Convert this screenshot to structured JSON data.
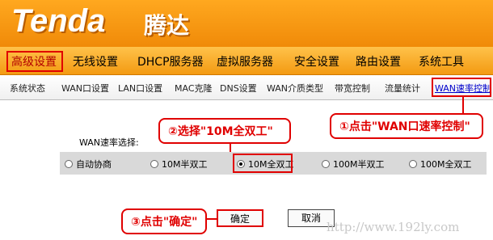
{
  "brand": {
    "logo": "Tenda",
    "logo_cn": "腾达"
  },
  "main_nav": [
    {
      "label": "高级设置",
      "active": true
    },
    {
      "label": "无线设置",
      "active": false
    },
    {
      "label": "DHCP服务器",
      "active": false
    },
    {
      "label": "虚拟服务器",
      "active": false
    },
    {
      "label": "安全设置",
      "active": false
    },
    {
      "label": "路由设置",
      "active": false
    },
    {
      "label": "系统工具",
      "active": false
    }
  ],
  "sub_nav": [
    {
      "label": "系统状态"
    },
    {
      "label": "WAN口设置"
    },
    {
      "label": "LAN口设置"
    },
    {
      "label": "MAC克隆"
    },
    {
      "label": "DNS设置"
    },
    {
      "label": "WAN介质类型"
    },
    {
      "label": "带宽控制"
    },
    {
      "label": "流量统计"
    },
    {
      "label": "WAN速率控制"
    }
  ],
  "form": {
    "rate_label": "WAN速率选择:",
    "options": [
      {
        "label": "自动协商",
        "selected": false
      },
      {
        "label": "10M半双工",
        "selected": false
      },
      {
        "label": "10M全双工",
        "selected": true
      },
      {
        "label": "100M半双工",
        "selected": false
      },
      {
        "label": "100M全双工",
        "selected": false
      }
    ],
    "ok_label": "确定",
    "cancel_label": "取消"
  },
  "callouts": {
    "step1": "①点击\"WAN口速率控制\"",
    "step2": "②选择\"10M全双工\"",
    "step3": "③点击\"确定\""
  },
  "watermark": "http://www.192ly.com",
  "colors": {
    "header": "#f39a12",
    "annotation": "#e00000",
    "active_link": "#0000cc"
  }
}
